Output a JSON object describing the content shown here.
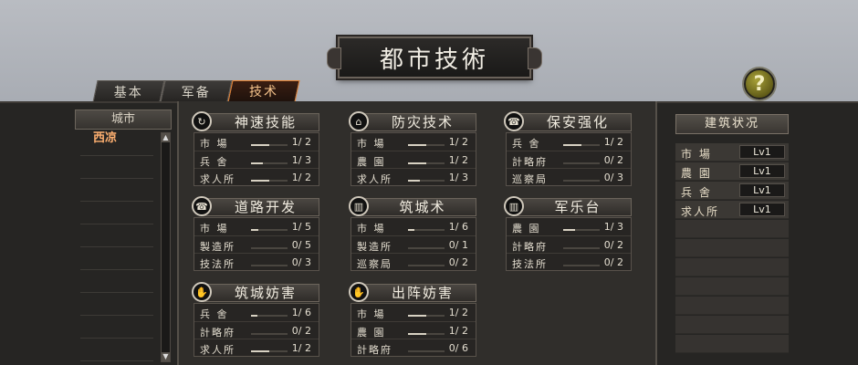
{
  "title": "都市技術",
  "tabs": [
    {
      "label": "基本"
    },
    {
      "label": "军备"
    },
    {
      "label": "技术"
    }
  ],
  "help": "?",
  "city_panel": {
    "header": "城市",
    "items": [
      "西凉"
    ]
  },
  "techs": [
    {
      "name": "神速技能",
      "icon": "rotate-icon",
      "rows": [
        {
          "label": "市 場",
          "progress": 0.5,
          "value": "1/ 2"
        },
        {
          "label": "兵 舍",
          "progress": 0.33,
          "value": "1/ 3"
        },
        {
          "label": "求人所",
          "progress": 0.5,
          "value": "1/ 2"
        }
      ]
    },
    {
      "name": "防灾技术",
      "icon": "house-icon",
      "rows": [
        {
          "label": "市 場",
          "progress": 0.5,
          "value": "1/ 2"
        },
        {
          "label": "農 園",
          "progress": 0.5,
          "value": "1/ 2"
        },
        {
          "label": "求人所",
          "progress": 0.33,
          "value": "1/ 3"
        }
      ]
    },
    {
      "name": "保安强化",
      "icon": "phone-icon",
      "rows": [
        {
          "label": "兵 舍",
          "progress": 0.5,
          "value": "1/ 2"
        },
        {
          "label": "計略府",
          "progress": 0,
          "value": "0/ 2"
        },
        {
          "label": "巡察局",
          "progress": 0,
          "value": "0/ 3"
        }
      ]
    },
    {
      "name": "道路开发",
      "icon": "phone-icon",
      "rows": [
        {
          "label": "市 場",
          "progress": 0.2,
          "value": "1/ 5"
        },
        {
          "label": "製造所",
          "progress": 0,
          "value": "0/ 5"
        },
        {
          "label": "技法所",
          "progress": 0,
          "value": "0/ 3"
        }
      ]
    },
    {
      "name": "筑城术",
      "icon": "wall-icon",
      "rows": [
        {
          "label": "市 場",
          "progress": 0.17,
          "value": "1/ 6"
        },
        {
          "label": "製造所",
          "progress": 0,
          "value": "0/ 1"
        },
        {
          "label": "巡察局",
          "progress": 0,
          "value": "0/ 2"
        }
      ]
    },
    {
      "name": "军乐台",
      "icon": "wall-icon",
      "rows": [
        {
          "label": "農 園",
          "progress": 0.33,
          "value": "1/ 3"
        },
        {
          "label": "計略府",
          "progress": 0,
          "value": "0/ 2"
        },
        {
          "label": "技法所",
          "progress": 0,
          "value": "0/ 2"
        }
      ]
    },
    {
      "name": "筑城妨害",
      "icon": "hand-icon",
      "rows": [
        {
          "label": "兵 舍",
          "progress": 0.17,
          "value": "1/ 6"
        },
        {
          "label": "計略府",
          "progress": 0,
          "value": "0/ 2"
        },
        {
          "label": "求人所",
          "progress": 0.5,
          "value": "1/ 2"
        }
      ]
    },
    {
      "name": "出阵妨害",
      "icon": "hand-icon",
      "rows": [
        {
          "label": "市 場",
          "progress": 0.5,
          "value": "1/ 2"
        },
        {
          "label": "農 園",
          "progress": 0.5,
          "value": "1/ 2"
        },
        {
          "label": "計略府",
          "progress": 0,
          "value": "0/ 6"
        }
      ]
    }
  ],
  "build_status": {
    "header": "建筑状况",
    "items": [
      {
        "name": "市 場",
        "level": "Lv1"
      },
      {
        "name": "農 園",
        "level": "Lv1"
      },
      {
        "name": "兵 舍",
        "level": "Lv1"
      },
      {
        "name": "求人所",
        "level": "Lv1"
      }
    ]
  }
}
